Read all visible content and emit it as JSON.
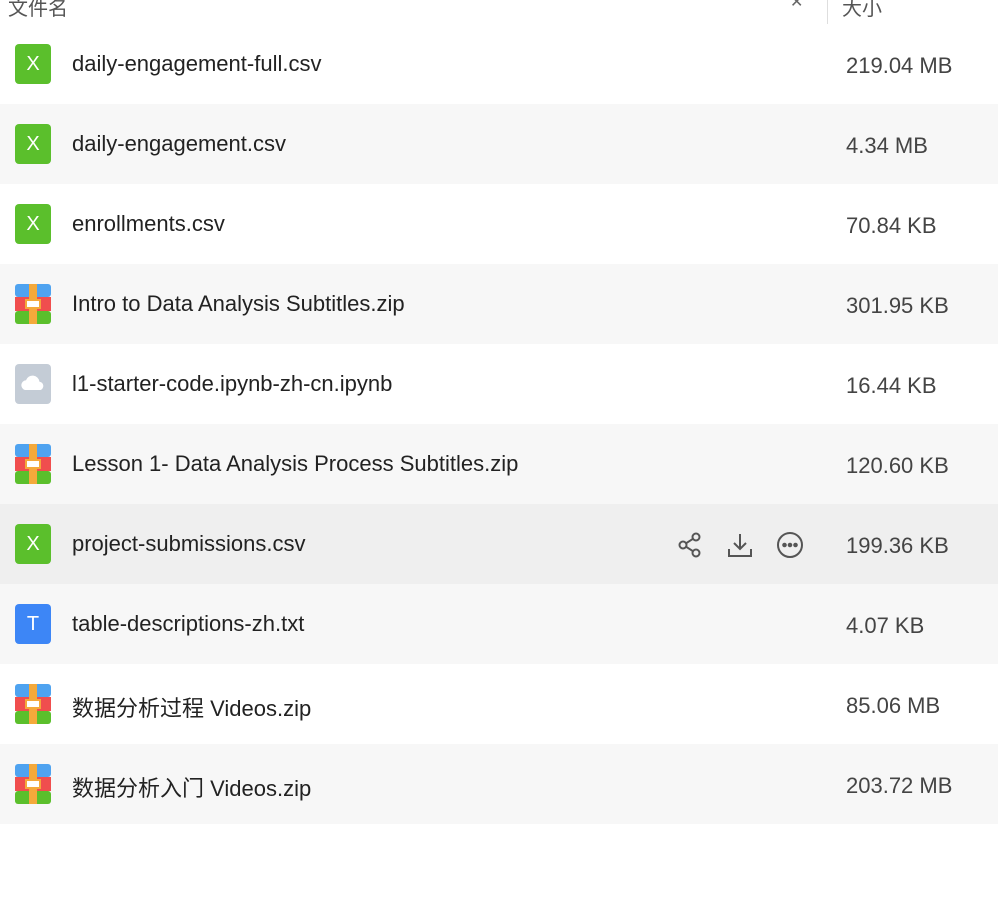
{
  "header": {
    "name_label": "文件名",
    "size_label": "大小"
  },
  "files": [
    {
      "name": "daily-engagement-full.csv",
      "size": "219.04 MB",
      "icon": "excel-icon"
    },
    {
      "name": "daily-engagement.csv",
      "size": "4.34 MB",
      "icon": "excel-icon"
    },
    {
      "name": "enrollments.csv",
      "size": "70.84 KB",
      "icon": "excel-icon"
    },
    {
      "name": "Intro to Data Analysis Subtitles.zip",
      "size": "301.95 KB",
      "icon": "zip-archive-icon"
    },
    {
      "name": "l1-starter-code.ipynb-zh-cn.ipynb",
      "size": "16.44 KB",
      "icon": "cloud-file-icon"
    },
    {
      "name": "Lesson 1- Data Analysis Process Subtitles.zip",
      "size": "120.60 KB",
      "icon": "zip-archive-icon"
    },
    {
      "name": "project-submissions.csv",
      "size": "199.36 KB",
      "icon": "excel-icon"
    },
    {
      "name": "table-descriptions-zh.txt",
      "size": "4.07 KB",
      "icon": "text-file-icon"
    },
    {
      "name": "数据分析过程 Videos.zip",
      "size": "85.06 MB",
      "icon": "zip-archive-icon"
    },
    {
      "name": "数据分析入门 Videos.zip",
      "size": "203.72 MB",
      "icon": "zip-archive-icon"
    }
  ],
  "icon_text": {
    "excel": "X",
    "text": "T"
  },
  "colors": {
    "excel": "#5bbf2c",
    "text_doc": "#3d86f6",
    "zip_top": "#4fa3f0",
    "zip_bottom": "#5bbf2c",
    "zip_mid": "#f04e4e",
    "zip_strap": "#f4a93b",
    "cloud_bg": "#c4ccd6",
    "row_alt": "#f7f7f7",
    "row_hover": "#efefef"
  }
}
